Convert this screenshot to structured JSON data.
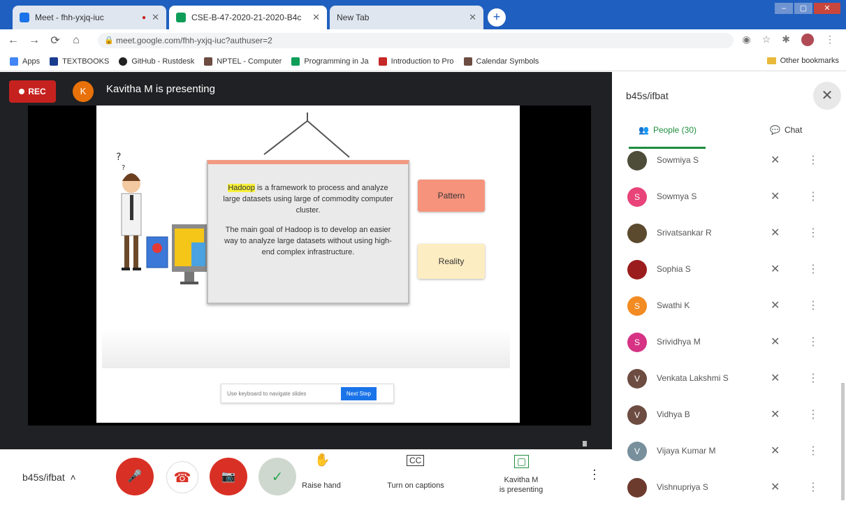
{
  "browser": {
    "tabs": [
      {
        "label": "Meet - fhh-yxjq-iuc",
        "color": "#1a73e8",
        "active": false
      },
      {
        "label": "CSE-B-47-2020-21-2020-B4c",
        "color": "#0f9d58",
        "active": true
      },
      {
        "label": "New Tab",
        "color": "#888888",
        "active": false
      }
    ],
    "new_tab": "+",
    "window_buttons": {
      "minimize": "–",
      "maximize": "▢",
      "close": "✕"
    },
    "address": "meet.google.com/fhh-yxjq-iuc?authuser=2",
    "nav": {
      "back": "←",
      "forward": "→",
      "reload": "⟳",
      "home": "⌂"
    },
    "bookmarks": [
      {
        "label": "Apps",
        "color": "#4285f4"
      },
      {
        "label": "TEXTBOOKS",
        "color": "#1a3c8f"
      },
      {
        "label": "GitHub - Rustdesk",
        "color": "#222222"
      },
      {
        "label": "NPTEL - Computer",
        "color": "#6d4c41"
      },
      {
        "label": "Programming in Ja",
        "color": "#0f9d58"
      },
      {
        "label": "Introduction to Pro",
        "color": "#c62828"
      },
      {
        "label": "Calendar Symbols",
        "color": "#6d4c41"
      }
    ],
    "other_bookmarks": "Other bookmarks"
  },
  "meet": {
    "rec_label": "REC",
    "presenter_initial": "K",
    "presenting_text": "Kavitha M is presenting",
    "slide": {
      "highlight": "Hadoop",
      "para1": "is a framework to process and analyze large datasets using large of commodity computer cluster.",
      "para2": "The main goal of Hadoop is to develop an easier way to analyze large datasets without using high-end complex infrastructure.",
      "button_a": "Pattern",
      "button_b": "Reality",
      "control_text": "Use keyboard to navigate slides",
      "control_button": "Next Step"
    },
    "meeting_code": "b45s/ifbat",
    "controls": {
      "mic_icon": "🎤",
      "hangup_icon": "☎",
      "camera_icon": "📷",
      "raise_hand": "Raise hand",
      "captions": "Turn on captions",
      "presenting": "Kavitha M\nis presenting",
      "more": "⋮"
    }
  },
  "panel": {
    "title": "b45s/ifbat",
    "close": "✕",
    "people_tab": "People (30)",
    "chat_tab": "Chat",
    "people": [
      {
        "name": "Sowmiya S",
        "initial": "",
        "color": "#4d4d3a"
      },
      {
        "name": "Sowmya S",
        "initial": "S",
        "color": "#e8447a"
      },
      {
        "name": "Srivatsankar R",
        "initial": "",
        "color": "#5b4a2e"
      },
      {
        "name": "Sophia S",
        "initial": "",
        "color": "#9b1c1c"
      },
      {
        "name": "Swathi K",
        "initial": "S",
        "color": "#f28b22"
      },
      {
        "name": "Srividhya M",
        "initial": "S",
        "color": "#d63384"
      },
      {
        "name": "Venkata Lakshmi S",
        "initial": "V",
        "color": "#6d4c41"
      },
      {
        "name": "Vidhya B",
        "initial": "V",
        "color": "#6d4c41"
      },
      {
        "name": "Vijaya Kumar M",
        "initial": "V",
        "color": "#78909c"
      },
      {
        "name": "Vishnupriya S",
        "initial": "",
        "color": "#6d3b2e"
      }
    ]
  }
}
